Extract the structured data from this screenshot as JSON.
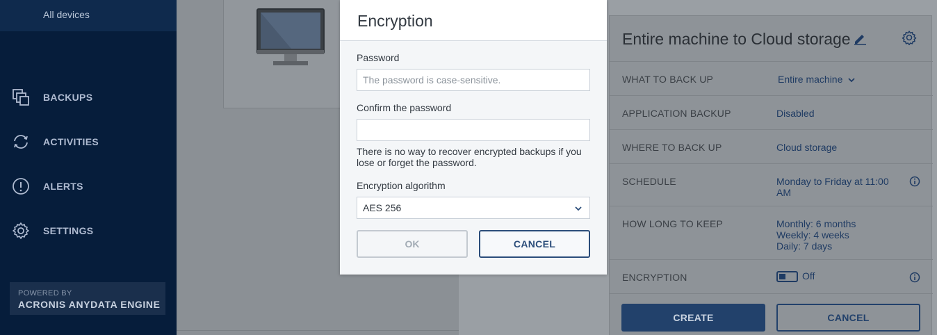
{
  "sidebar": {
    "all_devices": "All devices",
    "items": [
      {
        "label": "BACKUPS",
        "icon": "backups-icon"
      },
      {
        "label": "ACTIVITIES",
        "icon": "activities-icon"
      },
      {
        "label": "ALERTS",
        "icon": "alerts-icon"
      },
      {
        "label": "SETTINGS",
        "icon": "settings-icon"
      }
    ],
    "powered_by": "POWERED BY",
    "engine": "ACRONIS ANYDATA ENGINE"
  },
  "plan": {
    "title": "Entire machine to Cloud storage",
    "rows": [
      {
        "key": "WHAT TO BACK UP",
        "value": "Entire machine"
      },
      {
        "key": "APPLICATION BACKUP",
        "value": "Disabled"
      },
      {
        "key": "WHERE TO BACK UP",
        "value": "Cloud storage"
      },
      {
        "key": "SCHEDULE",
        "value": "Monday to Friday at 11:00 AM"
      },
      {
        "key": "HOW LONG TO KEEP",
        "value": "Monthly: 6 months",
        "value2": "Weekly: 4 weeks",
        "value3": "Daily: 7 days"
      },
      {
        "key": "ENCRYPTION",
        "value": "Off"
      }
    ],
    "create_label": "CREATE",
    "cancel_label": "CANCEL"
  },
  "dialog": {
    "title": "Encryption",
    "password_label": "Password",
    "password_placeholder": "The password is case-sensitive.",
    "confirm_label": "Confirm the password",
    "note": "There is no way to recover encrypted backups if you lose or forget the password.",
    "algorithm_label": "Encryption algorithm",
    "algorithm_value": "AES 256",
    "ok_label": "OK",
    "cancel_label": "CANCEL"
  },
  "colors": {
    "sidebar_bg": "#061d3b",
    "accent": "#2b4d7a",
    "dialog_bg": "#f4f6f8"
  }
}
